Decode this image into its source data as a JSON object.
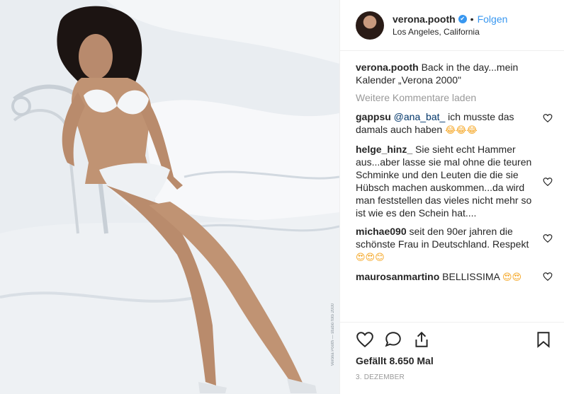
{
  "header": {
    "username": "verona.pooth",
    "verified_mark": "✔",
    "separator": "•",
    "follow_label": "Folgen",
    "location": "Los Angeles, California"
  },
  "photo": {
    "side_caption": "Verona Pooth — studio foto 2000"
  },
  "caption": {
    "user": "verona.pooth",
    "text": "Back in the day...mein Kalender „Verona 2000\""
  },
  "load_more_label": "Weitere Kommentare laden",
  "comments": [
    {
      "user": "gappsu",
      "mention": "@ana_bat_",
      "text": " ich musste das damals auch haben ",
      "emoji": "😂😂😂"
    },
    {
      "user": "helge_hinz_",
      "mention": "",
      "text": "Sie sieht echt Hammer aus...aber lasse sie mal ohne die teuren Schminke und den Leuten die die sie Hübsch machen auskommen...da wird man feststellen das vieles nicht mehr so ist wie es den Schein hat....",
      "emoji": ""
    },
    {
      "user": "michae090",
      "mention": "",
      "text": "seit den 90er jahren die schönste Frau in Deutschland. Respekt ",
      "emoji": "😍😍😊"
    },
    {
      "user": "maurosanmartino",
      "mention": "",
      "text": "BELLISSIMA ",
      "emoji": "😍😍"
    }
  ],
  "icons": {
    "like": "heart-icon",
    "comment": "comment-icon",
    "share": "share-icon",
    "save": "bookmark-icon"
  },
  "likes_label": "Gefällt 8.650 Mal",
  "date_label": "3. DEZEMBER",
  "colors": {
    "link_blue": "#3897f0",
    "text_dark": "#262626",
    "muted_gray": "#999999"
  }
}
